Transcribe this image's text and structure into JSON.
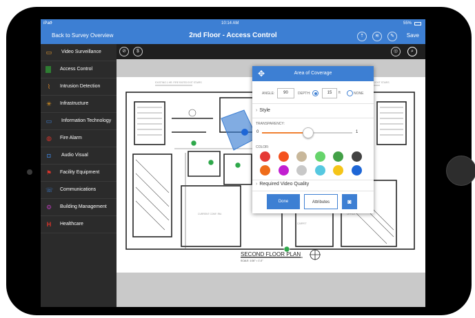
{
  "status_bar": {
    "carrier": "iPad",
    "time": "10:14 AM",
    "battery": "55%"
  },
  "nav": {
    "back_label": "Back to Survey Overview",
    "title": "2nd Floor - Access Control",
    "save_label": "Save",
    "icons": [
      "share-icon",
      "layers-icon",
      "edit-icon"
    ]
  },
  "toolbar": {
    "left_icons": [
      "no-entry-icon",
      "dollar-icon"
    ],
    "right_icons": [
      "camera-off-icon",
      "search-icon"
    ]
  },
  "sidebar": {
    "items": [
      {
        "label": "Video Surveillance",
        "icon": "camera-icon",
        "color": "#f0a030"
      },
      {
        "label": "Access Control",
        "icon": "door-icon",
        "color": "#2e7d32"
      },
      {
        "label": "Intrusion Detection",
        "icon": "sensor-icon",
        "color": "#e08a2a"
      },
      {
        "label": "Infrastructure",
        "icon": "network-icon",
        "color": "#f0a020"
      },
      {
        "label": "Information Technology",
        "icon": "computer-icon",
        "color": "#3d7fd3"
      },
      {
        "label": "Fire Alarm",
        "icon": "fire-icon",
        "color": "#d9342b"
      },
      {
        "label": "Audio Visual",
        "icon": "av-icon",
        "color": "#3d7fd3"
      },
      {
        "label": "Facility Equipment",
        "icon": "equipment-icon",
        "color": "#d9342b"
      },
      {
        "label": "Communications",
        "icon": "phone-icon",
        "color": "#3d7fd3"
      },
      {
        "label": "Building Management",
        "icon": "gear-icon",
        "color": "#b03ab0"
      },
      {
        "label": "Healthcare",
        "icon": "health-icon",
        "color": "#d9342b"
      }
    ]
  },
  "floorplan": {
    "title": "SECOND FLOOR PLAN",
    "scale": "SCALE: 1/16\" = 1'-0\""
  },
  "coverage_panel": {
    "title": "Area of Coverage",
    "angle_label": "ANGLE:",
    "angle_value": "90",
    "depth_label": "DEPTH:",
    "depth_value": "15",
    "depth_unit": "ft",
    "none_label": "NONE",
    "style_label": "Style",
    "transparency_label": "TRANSPARENCY:",
    "transparency_min": "0",
    "transparency_max": "1",
    "transparency_value": 0.5,
    "color_label": "COLOR:",
    "colors": [
      "#e53935",
      "#f4511e",
      "#c8b79a",
      "#66d46b",
      "#43a047",
      "#424242",
      "#ef6c1a",
      "#c21fd0",
      "#c8c8c8",
      "#56c8e0",
      "#f5c518",
      "#1e66d6"
    ],
    "video_quality_label": "Required Video Quality",
    "done_label": "Done",
    "attributes_label": "Attributes"
  }
}
